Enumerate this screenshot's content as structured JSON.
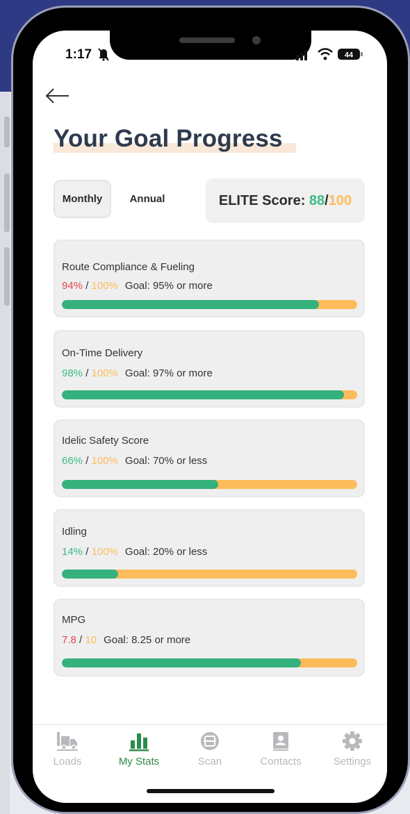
{
  "status_bar": {
    "time": "1:17",
    "battery": "44"
  },
  "page": {
    "title": "Your Goal Progress"
  },
  "toggle": {
    "monthly": "Monthly",
    "annual": "Annual",
    "selected": "Monthly"
  },
  "elite": {
    "label": "ELITE Score:",
    "score": "88",
    "separator": "/",
    "max": "100"
  },
  "metrics": [
    {
      "title": "Route Compliance & Fueling",
      "value": "94%",
      "separator": " / ",
      "total": "100%",
      "goal": "Goal: 95% or more",
      "progress": 0.87,
      "value_color": "#e5464a"
    },
    {
      "title": "On-Time Delivery",
      "value": "98%",
      "separator": " / ",
      "total": "100%",
      "goal": "Goal: 97% or more",
      "progress": 0.955,
      "value_color": "#3dba85"
    },
    {
      "title": "Idelic Safety Score",
      "value": "66%",
      "separator": " / ",
      "total": "100%",
      "goal": "Goal: 70% or less",
      "progress": 0.53,
      "value_color": "#3dba85"
    },
    {
      "title": "Idling",
      "value": "14%",
      "separator": " / ",
      "total": "100%",
      "goal": "Goal: 20% or less",
      "progress": 0.19,
      "value_color": "#3dba85"
    },
    {
      "title": "MPG",
      "value": "7.8",
      "separator": " / ",
      "total": "10",
      "goal": "Goal: 8.25 or more",
      "progress": 0.81,
      "value_color": "#e5464a"
    }
  ],
  "tabs": [
    {
      "label": "Loads",
      "icon": "truck-icon",
      "active": false
    },
    {
      "label": "My Stats",
      "icon": "bar-chart-icon",
      "active": true
    },
    {
      "label": "Scan",
      "icon": "scan-icon",
      "active": false
    },
    {
      "label": "Contacts",
      "icon": "contacts-icon",
      "active": false
    },
    {
      "label": "Settings",
      "icon": "gear-icon",
      "active": false
    }
  ],
  "colors": {
    "green": "#3dba85",
    "orange": "#fdbc5b",
    "red": "#e5464a",
    "title": "#2e3a4d",
    "active_tab": "#2e8a4a"
  }
}
